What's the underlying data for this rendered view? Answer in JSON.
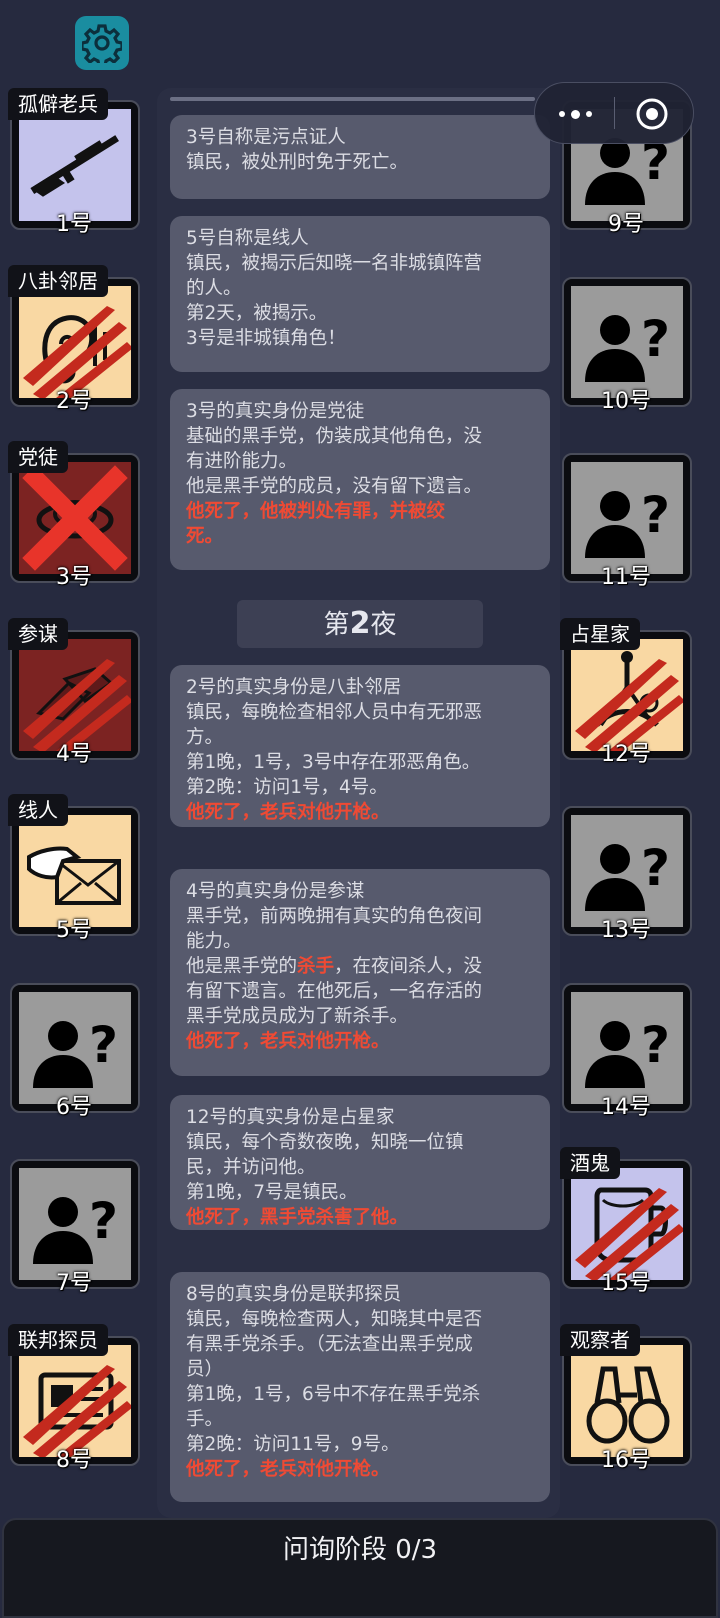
{
  "players_left": [
    {
      "num": "1号",
      "tag": "孤僻老兵",
      "bg": "lav",
      "icon": "rifle-icon",
      "status": "alive"
    },
    {
      "num": "2号",
      "tag": "八卦邻居",
      "bg": "town",
      "icon": "ear-icon",
      "status": "dead"
    },
    {
      "num": "3号",
      "tag": "党徒",
      "bg": "mafia",
      "icon": "mask-icon",
      "status": "executed"
    },
    {
      "num": "4号",
      "tag": "参谋",
      "bg": "mafia",
      "icon": "hands-icon",
      "status": "dead"
    },
    {
      "num": "5号",
      "tag": "线人",
      "bg": "town",
      "icon": "envelope-icon",
      "status": "alive"
    },
    {
      "num": "6号",
      "tag": "",
      "bg": "unknown",
      "icon": "unknown-user-icon",
      "status": "alive"
    },
    {
      "num": "7号",
      "tag": "",
      "bg": "unknown",
      "icon": "unknown-user-icon",
      "status": "alive"
    },
    {
      "num": "8号",
      "tag": "联邦探员",
      "bg": "town",
      "icon": "badge-icon",
      "status": "dead"
    }
  ],
  "players_right": [
    {
      "num": "9号",
      "tag": "",
      "bg": "unknown",
      "icon": "unknown-user-icon",
      "status": "alive"
    },
    {
      "num": "10号",
      "tag": "",
      "bg": "unknown",
      "icon": "unknown-user-icon",
      "status": "alive"
    },
    {
      "num": "11号",
      "tag": "",
      "bg": "unknown",
      "icon": "unknown-user-icon",
      "status": "alive"
    },
    {
      "num": "12号",
      "tag": "占星家",
      "bg": "town",
      "icon": "sextant-icon",
      "status": "dead"
    },
    {
      "num": "13号",
      "tag": "",
      "bg": "unknown",
      "icon": "unknown-user-icon",
      "status": "alive"
    },
    {
      "num": "14号",
      "tag": "",
      "bg": "unknown",
      "icon": "unknown-user-icon",
      "status": "alive"
    },
    {
      "num": "15号",
      "tag": "酒鬼",
      "bg": "lav",
      "icon": "drunk-icon",
      "status": "dead"
    },
    {
      "num": "16号",
      "tag": "观察者",
      "bg": "town",
      "icon": "binoculars-icon",
      "status": "alive"
    }
  ],
  "log": {
    "c1": {
      "l1": "3号自称是污点证人",
      "l2": "镇民，被处刑时免于死亡。"
    },
    "c2": {
      "l1": "5号自称是线人",
      "l2": "镇民，被揭示后知晓一名非城镇阵营",
      "l3": "的人。",
      "l4": "第2天，被揭示。",
      "l5": "3号是非城镇角色！"
    },
    "c3": {
      "l1": "3号的真实身份是党徒",
      "l2": "基础的黑手党，伪装成其他角色，没",
      "l3": "有进阶能力。",
      "l4": "他是黑手党的成员，没有留下遗言。",
      "l5": "他死了，他被判处有罪，并被绞",
      "l6": "死。"
    },
    "night": {
      "pre": "第",
      "num": "2",
      "post": "夜"
    },
    "c4": {
      "l1": "2号的真实身份是八卦邻居",
      "l2": "镇民，每晚检查相邻人员中有无邪恶",
      "l3": "方。",
      "l4": "第1晚，1号，3号中存在邪恶角色。",
      "l5": "第2晚：访问1号，4号。",
      "l6": "他死了，老兵对他开枪。"
    },
    "c5": {
      "l1": "4号的真实身份是参谋",
      "l2": "黑手党，前两晚拥有真实的角色夜间",
      "l3": "能力。",
      "l4a": "他是黑手党的",
      "l4b": "杀手",
      "l4c": "，在夜间杀人，没",
      "l5": "有留下遗言。在他死后，一名存活的",
      "l6": "黑手党成员成为了新杀手。",
      "l7": "他死了，老兵对他开枪。"
    },
    "c6": {
      "l1": "12号的真实身份是占星家",
      "l2": "镇民，每个奇数夜晚，知晓一位镇",
      "l3": "民，并访问他。",
      "l4": "第1晚，7号是镇民。",
      "l5": "他死了，黑手党杀害了他。"
    },
    "c7": {
      "l1": "8号的真实身份是联邦探员",
      "l2": "镇民，每晚检查两人，知晓其中是否",
      "l3": "有黑手党杀手。（无法查出黑手党成",
      "l4": "员）",
      "l5": "第1晚，1号，6号中不存在黑手党杀",
      "l6": "手。",
      "l7": "第2晚：访问11号，9号。",
      "l8": "他死了，老兵对他开枪。"
    }
  },
  "bottom": {
    "phase": "问询阶段 0/3"
  },
  "colors": {
    "accent_red": "#ef4a34",
    "town_bg": "#f9d8a3",
    "mafia_bg": "#7c2322",
    "settings_bg": "#1a8da0"
  }
}
